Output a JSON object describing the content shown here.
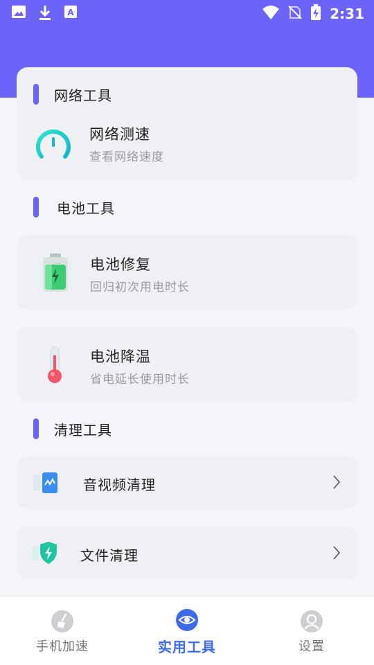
{
  "status_bar": {
    "time": "2:31",
    "left_icons": [
      "image-icon",
      "download-icon",
      "font-icon"
    ],
    "right_icons": [
      "wifi-icon",
      "no-sim-icon",
      "battery-charging-icon"
    ]
  },
  "colors": {
    "header": "#6c63fb",
    "accent_bar": "#6c63fb",
    "active_nav": "#3f6be8"
  },
  "sections": {
    "network": {
      "title": "网络工具",
      "items": [
        {
          "title": "网络测速",
          "subtitle": "查看网络速度",
          "icon": "speedometer-icon"
        }
      ]
    },
    "battery": {
      "title": "电池工具",
      "items": [
        {
          "title": "电池修复",
          "subtitle": "回归初次用电时长",
          "icon": "battery-icon"
        },
        {
          "title": "电池降温",
          "subtitle": "省电延长使用时长",
          "icon": "thermometer-icon"
        }
      ]
    },
    "clean": {
      "title": "清理工具",
      "items": [
        {
          "title": "音视频清理",
          "icon": "media-file-icon"
        },
        {
          "title": "文件清理",
          "icon": "shield-bolt-icon"
        }
      ]
    }
  },
  "bottom_nav": {
    "items": [
      {
        "label": "手机加速",
        "icon": "broom-icon",
        "active": false
      },
      {
        "label": "实用工具",
        "icon": "eye-icon",
        "active": true
      },
      {
        "label": "设置",
        "icon": "user-icon",
        "active": false
      }
    ]
  }
}
